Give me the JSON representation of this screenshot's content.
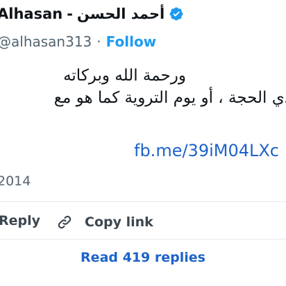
{
  "header": {
    "name_latin": "Alhasan",
    "separator": "-",
    "name_arabic": "أحمد الحسن",
    "handle": "@alhasan313",
    "dot": "·",
    "follow_label": "Follow"
  },
  "tweet": {
    "line1": "ورحمة الله وبركاته",
    "line2": "ذي الحجة ، أو يوم التروية كما هو مع",
    "link": "fb.me/39iM04LXc",
    "date": "2014"
  },
  "actions": {
    "reply_label": "Reply",
    "copy_link_label": "Copy link",
    "read_replies_label": "Read 419 replies"
  },
  "colors": {
    "accent": "#1d9bf0",
    "link": "#1d63c8",
    "muted": "#536471"
  }
}
